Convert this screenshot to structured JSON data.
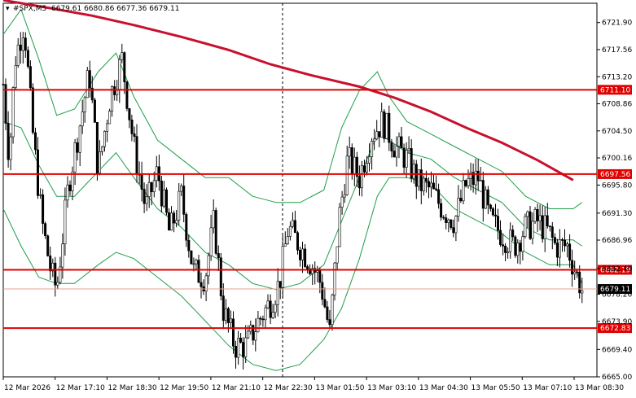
{
  "header": {
    "symbol": "#SPX,M5",
    "ohlc": "6679.61 6680.86 6677.36 6679.11"
  },
  "chart_data": {
    "type": "candlestick",
    "symbol": "#SPX",
    "timeframe": "M5",
    "ylim": [
      6665.0,
      6725.0
    ],
    "y_ticks": [
      "6721.90",
      "6717.56",
      "6713.20",
      "6708.86",
      "6704.50",
      "6700.16",
      "6695.80",
      "6691.30",
      "6686.96",
      "6682.40",
      "6678.26",
      "6673.90",
      "6669.40",
      "6665.00"
    ],
    "x_ticks": [
      "12 Mar 2026",
      "12 Mar 17:10",
      "12 Mar 18:30",
      "12 Mar 19:50",
      "12 Mar 21:10",
      "12 Mar 22:30",
      "13 Mar 01:50",
      "13 Mar 03:10",
      "13 Mar 04:30",
      "13 Mar 05:50",
      "13 Mar 07:10",
      "13 Mar 08:30"
    ],
    "session_break": "12 Mar 22:30",
    "last_price": {
      "value": 6679.11,
      "label": "6679.11"
    },
    "levels": [
      {
        "value": 6711.1,
        "label": "6711.10"
      },
      {
        "value": 6697.56,
        "label": "6697.56"
      },
      {
        "value": 6682.19,
        "label": "6682.19"
      },
      {
        "value": 6672.83,
        "label": "6672.83"
      }
    ],
    "moving_average": {
      "name": "MA",
      "color": "#c8102e",
      "points": [
        [
          0,
          6725.5
        ],
        [
          0.08,
          6724.2
        ],
        [
          0.15,
          6723.0
        ],
        [
          0.22,
          6721.5
        ],
        [
          0.3,
          6719.6
        ],
        [
          0.38,
          6717.5
        ],
        [
          0.45,
          6715.2
        ],
        [
          0.52,
          6713.4
        ],
        [
          0.6,
          6711.6
        ],
        [
          0.66,
          6709.8
        ],
        [
          0.72,
          6707.6
        ],
        [
          0.78,
          6705.0
        ],
        [
          0.84,
          6702.6
        ],
        [
          0.9,
          6699.8
        ],
        [
          0.96,
          6696.6
        ]
      ]
    },
    "bollinger_upper": [
      [
        0,
        6720
      ],
      [
        0.03,
        6724
      ],
      [
        0.06,
        6716
      ],
      [
        0.09,
        6707
      ],
      [
        0.12,
        6708
      ],
      [
        0.16,
        6714
      ],
      [
        0.19,
        6717
      ],
      [
        0.22,
        6710
      ],
      [
        0.26,
        6703
      ],
      [
        0.3,
        6700
      ],
      [
        0.34,
        6697
      ],
      [
        0.38,
        6697
      ],
      [
        0.42,
        6694
      ],
      [
        0.46,
        6693
      ],
      [
        0.5,
        6693
      ],
      [
        0.54,
        6695
      ],
      [
        0.57,
        6705
      ],
      [
        0.6,
        6711
      ],
      [
        0.63,
        6714
      ],
      [
        0.65,
        6710
      ],
      [
        0.68,
        6706
      ],
      [
        0.72,
        6704
      ],
      [
        0.76,
        6702
      ],
      [
        0.8,
        6700
      ],
      [
        0.84,
        6698
      ],
      [
        0.88,
        6694
      ],
      [
        0.92,
        6692
      ],
      [
        0.96,
        6692
      ],
      [
        0.975,
        6693
      ]
    ],
    "bollinger_lower": [
      [
        0,
        6692
      ],
      [
        0.03,
        6686
      ],
      [
        0.06,
        6681
      ],
      [
        0.09,
        6680
      ],
      [
        0.12,
        6680
      ],
      [
        0.16,
        6683
      ],
      [
        0.19,
        6685
      ],
      [
        0.22,
        6684
      ],
      [
        0.26,
        6681
      ],
      [
        0.3,
        6678
      ],
      [
        0.34,
        6674
      ],
      [
        0.38,
        6670
      ],
      [
        0.42,
        6667
      ],
      [
        0.46,
        6666
      ],
      [
        0.5,
        6667
      ],
      [
        0.54,
        6671
      ],
      [
        0.57,
        6676
      ],
      [
        0.6,
        6684
      ],
      [
        0.63,
        6694
      ],
      [
        0.65,
        6697
      ],
      [
        0.68,
        6697
      ],
      [
        0.72,
        6696
      ],
      [
        0.76,
        6692
      ],
      [
        0.8,
        6690
      ],
      [
        0.84,
        6688
      ],
      [
        0.88,
        6685
      ],
      [
        0.92,
        6683
      ],
      [
        0.96,
        6683
      ],
      [
        0.975,
        6680
      ]
    ],
    "bollinger_middle": [
      [
        0,
        6706
      ],
      [
        0.03,
        6705
      ],
      [
        0.06,
        6699
      ],
      [
        0.09,
        6694
      ],
      [
        0.12,
        6694
      ],
      [
        0.16,
        6698
      ],
      [
        0.19,
        6701
      ],
      [
        0.22,
        6697
      ],
      [
        0.26,
        6692
      ],
      [
        0.3,
        6689
      ],
      [
        0.34,
        6685
      ],
      [
        0.38,
        6683
      ],
      [
        0.42,
        6680
      ],
      [
        0.46,
        6679
      ],
      [
        0.5,
        6680
      ],
      [
        0.54,
        6683
      ],
      [
        0.57,
        6690
      ],
      [
        0.6,
        6697
      ],
      [
        0.63,
        6704
      ],
      [
        0.65,
        6703
      ],
      [
        0.68,
        6701
      ],
      [
        0.72,
        6700
      ],
      [
        0.76,
        6697
      ],
      [
        0.8,
        6695
      ],
      [
        0.84,
        6693
      ],
      [
        0.88,
        6689
      ],
      [
        0.92,
        6687
      ],
      [
        0.96,
        6687
      ],
      [
        0.975,
        6686
      ]
    ],
    "path_anchors": [
      [
        0,
        6712
      ],
      [
        0.01,
        6700
      ],
      [
        0.02,
        6716
      ],
      [
        0.035,
        6722
      ],
      [
        0.05,
        6704
      ],
      [
        0.065,
        6690
      ],
      [
        0.08,
        6682
      ],
      [
        0.09,
        6679
      ],
      [
        0.11,
        6696
      ],
      [
        0.13,
        6706
      ],
      [
        0.145,
        6714
      ],
      [
        0.16,
        6698
      ],
      [
        0.18,
        6710
      ],
      [
        0.2,
        6716
      ],
      [
        0.22,
        6702
      ],
      [
        0.24,
        6692
      ],
      [
        0.26,
        6698
      ],
      [
        0.28,
        6688
      ],
      [
        0.3,
        6694
      ],
      [
        0.32,
        6682
      ],
      [
        0.34,
        6681
      ],
      [
        0.355,
        6690
      ],
      [
        0.37,
        6676
      ],
      [
        0.39,
        6670
      ],
      [
        0.41,
        6670
      ],
      [
        0.43,
        6674
      ],
      [
        0.45,
        6677
      ],
      [
        0.465,
        6680
      ],
      [
        0.48,
        6689
      ],
      [
        0.5,
        6686
      ],
      [
        0.52,
        6683
      ],
      [
        0.535,
        6680
      ],
      [
        0.55,
        6672
      ],
      [
        0.565,
        6690
      ],
      [
        0.58,
        6700
      ],
      [
        0.6,
        6697
      ],
      [
        0.62,
        6704
      ],
      [
        0.64,
        6706
      ],
      [
        0.66,
        6702
      ],
      [
        0.68,
        6700
      ],
      [
        0.7,
        6696
      ],
      [
        0.72,
        6695
      ],
      [
        0.74,
        6692
      ],
      [
        0.76,
        6690
      ],
      [
        0.78,
        6696
      ],
      [
        0.8,
        6697
      ],
      [
        0.82,
        6690
      ],
      [
        0.84,
        6688
      ],
      [
        0.86,
        6686
      ],
      [
        0.88,
        6689
      ],
      [
        0.9,
        6690
      ],
      [
        0.92,
        6688
      ],
      [
        0.93,
        6686
      ],
      [
        0.95,
        6686
      ],
      [
        0.96,
        6683
      ],
      [
        0.975,
        6679
      ]
    ]
  }
}
